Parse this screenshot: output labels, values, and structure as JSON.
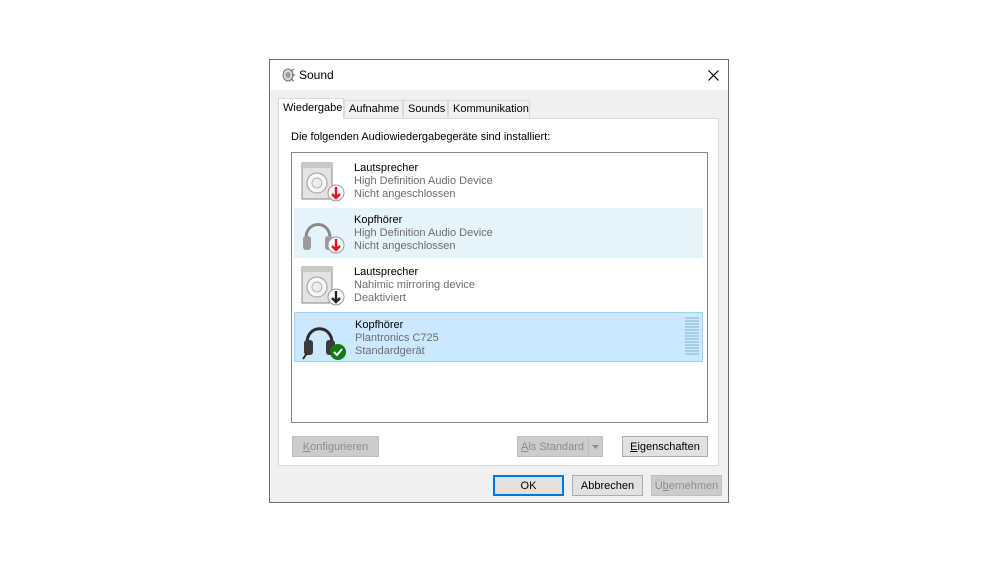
{
  "window": {
    "title": "Sound",
    "close_glyph": "✕"
  },
  "tabs": [
    {
      "label": "Wiedergabe",
      "active": true
    },
    {
      "label": "Aufnahme"
    },
    {
      "label": "Sounds"
    },
    {
      "label": "Kommunikation"
    }
  ],
  "playback": {
    "heading": "Die folgenden Audiowiedergabegeräte sind installiert:",
    "devices": [
      {
        "name": "Lautsprecher",
        "driver": "High Definition Audio Device",
        "status": "Nicht angeschlossen",
        "icon": "speaker-icon",
        "badge": "unplugged-badge-icon",
        "badge_color": "#e81123"
      },
      {
        "name": "Kopfhörer",
        "driver": "High Definition Audio Device",
        "status": "Nicht angeschlossen",
        "icon": "headphones-icon",
        "badge": "unplugged-badge-icon",
        "badge_color": "#e81123"
      },
      {
        "name": "Lautsprecher",
        "driver": "Nahimic mirroring device",
        "status": "Deaktiviert",
        "icon": "speaker-icon",
        "badge": "disabled-badge-icon",
        "badge_color": "#222222"
      },
      {
        "name": "Kopfhörer",
        "driver": "Plantronics C725",
        "status": "Standardgerät",
        "icon": "headset-icon",
        "badge": "default-check-badge-icon",
        "badge_color": "#107c10",
        "selected": true
      }
    ]
  },
  "buttons": {
    "configure": {
      "accel": "K",
      "rest": "onfigurieren"
    },
    "set_default": {
      "accel": "A",
      "rest": "ls Standard"
    },
    "properties": {
      "accel": "E",
      "rest": "igenschaften"
    },
    "ok": "OK",
    "cancel": "Abbrechen",
    "apply": {
      "pre": "Ü",
      "accel": "b",
      "rest": "ernehmen"
    }
  },
  "colors": {
    "accent": "#0078d7",
    "selection": "#cce8ff",
    "hover": "#e5f3fb"
  }
}
